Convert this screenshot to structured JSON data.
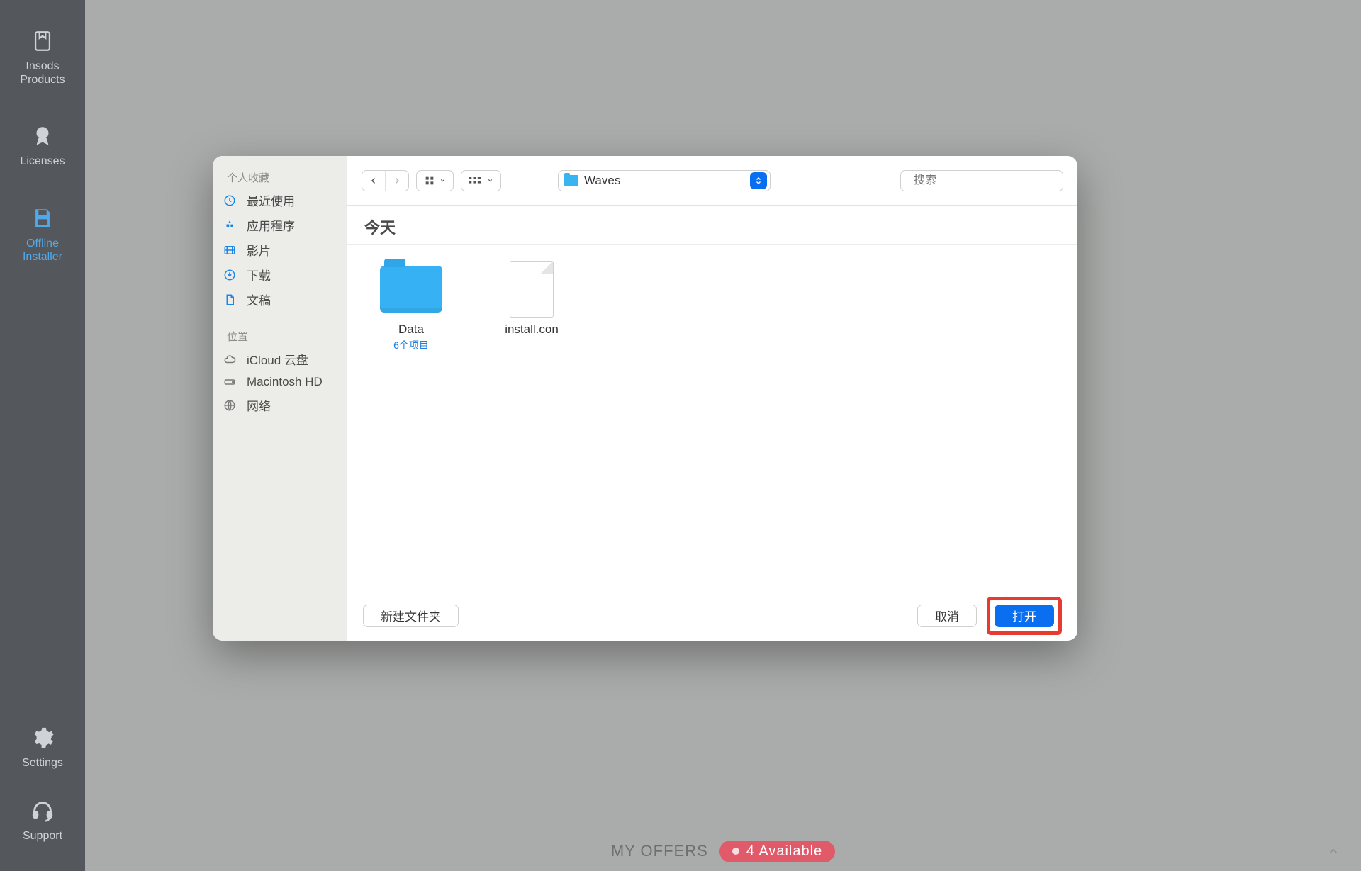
{
  "app_sidebar": {
    "items": [
      {
        "label": "Insods\nProducts"
      },
      {
        "label": "Licenses"
      },
      {
        "label": "Offline\nInstaller"
      },
      {
        "label": "Settings"
      },
      {
        "label": "Support"
      }
    ]
  },
  "finder": {
    "sidebar": {
      "favorites_title": "个人收藏",
      "items": [
        {
          "label": "最近使用"
        },
        {
          "label": "应用程序"
        },
        {
          "label": "影片"
        },
        {
          "label": "下载"
        },
        {
          "label": "文稿"
        }
      ],
      "locations_title": "位置",
      "locations": [
        {
          "label": "iCloud 云盘"
        },
        {
          "label": "Macintosh HD"
        },
        {
          "label": "网络"
        }
      ]
    },
    "toolbar": {
      "path_label": "Waves",
      "search_placeholder": "搜索"
    },
    "section_title": "今天",
    "files": [
      {
        "name": "Data",
        "meta": "6个项目",
        "kind": "folder"
      },
      {
        "name": "install.con",
        "kind": "doc"
      }
    ],
    "footer": {
      "new_folder": "新建文件夹",
      "cancel": "取消",
      "open": "打开"
    }
  },
  "offers": {
    "label": "MY OFFERS",
    "badge": "4 Available"
  }
}
